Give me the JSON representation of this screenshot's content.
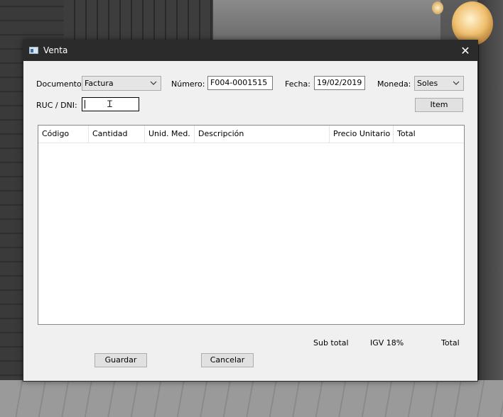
{
  "window": {
    "title": "Venta",
    "close_glyph": "✕"
  },
  "form": {
    "documento_label": "Documento:",
    "documento_value": "Factura",
    "numero_label": "Número:",
    "numero_value": "F004-0001515",
    "fecha_label": "Fecha:",
    "fecha_value": "19/02/2019",
    "moneda_label": "Moneda:",
    "moneda_value": "Soles",
    "ruc_label": "RUC / DNI:",
    "ruc_value": "",
    "item_button": "Item"
  },
  "table": {
    "columns": [
      "Código",
      "Cantidad",
      "Unid. Med.",
      "Descripción",
      "Precio Unitario",
      "Total"
    ],
    "rows": []
  },
  "totals": {
    "subtotal_label": "Sub total",
    "igv_label": "IGV 18%",
    "total_label": "Total"
  },
  "actions": {
    "guardar": "Guardar",
    "cancelar": "Cancelar"
  },
  "icons": [
    "window-app-icon",
    "close-icon",
    "chevron-down-icon",
    "text-cursor-icon"
  ]
}
